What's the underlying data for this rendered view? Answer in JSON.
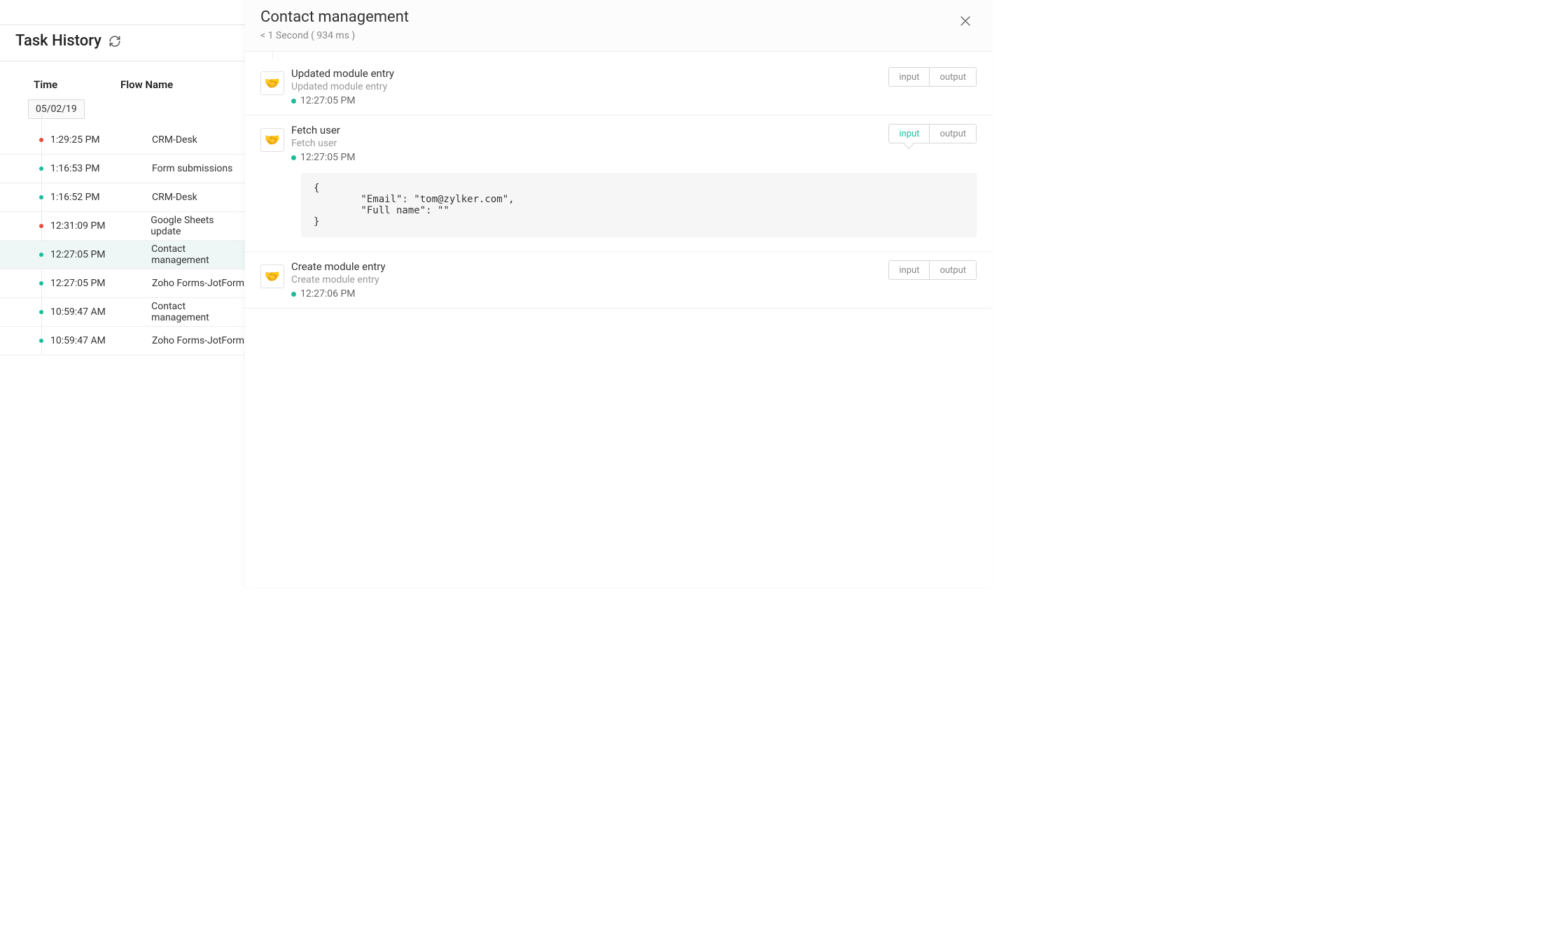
{
  "header": {
    "title": "Task History"
  },
  "columns": {
    "time": "Time",
    "flow": "Flow Name"
  },
  "date_chip": "05/02/19",
  "tasks": [
    {
      "status": "red",
      "time": "1:29:25 PM",
      "flow": "CRM-Desk",
      "selected": false
    },
    {
      "status": "green",
      "time": "1:16:53 PM",
      "flow": "Form submissions",
      "selected": false
    },
    {
      "status": "green",
      "time": "1:16:52 PM",
      "flow": "CRM-Desk",
      "selected": false
    },
    {
      "status": "red",
      "time": "12:31:09 PM",
      "flow": "Google Sheets update",
      "selected": false
    },
    {
      "status": "green",
      "time": "12:27:05 PM",
      "flow": "Contact management",
      "selected": true
    },
    {
      "status": "green",
      "time": "12:27:05 PM",
      "flow": "Zoho Forms-JotForm",
      "selected": false
    },
    {
      "status": "green",
      "time": "10:59:47 AM",
      "flow": "Contact management",
      "selected": false
    },
    {
      "status": "green",
      "time": "10:59:47 AM",
      "flow": "Zoho Forms-JotForm",
      "selected": false
    }
  ],
  "detail": {
    "title": "Contact management",
    "subtitle": "< 1 Second ( 934 ms )",
    "io_labels": {
      "input": "input",
      "output": "output"
    },
    "steps": [
      {
        "title": "Updated module entry",
        "subtitle": "Updated module entry",
        "time": "12:27:05 PM",
        "expanded": false,
        "active_tab": null,
        "code": null
      },
      {
        "title": "Fetch user",
        "subtitle": "Fetch user",
        "time": "12:27:05 PM",
        "expanded": true,
        "active_tab": "input",
        "code": "{\n        \"Email\": \"tom@zylker.com\",\n        \"Full name\": \"\"\n}"
      },
      {
        "title": "Create module entry",
        "subtitle": "Create module entry",
        "time": "12:27:06 PM",
        "expanded": false,
        "active_tab": null,
        "code": null
      }
    ]
  }
}
